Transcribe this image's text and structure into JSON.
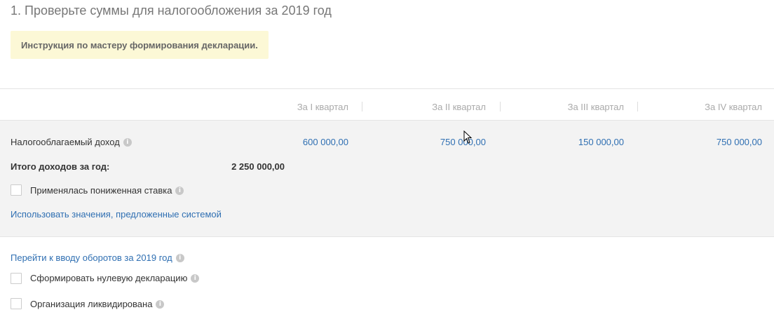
{
  "page": {
    "title": "1. Проверьте суммы для налогообложения за 2019 год"
  },
  "hint": {
    "link_text": "Инструкция по мастеру формирования декларации",
    "suffix": "."
  },
  "quarters": {
    "headers": [
      "За I квартал",
      "За II квартал",
      "За III квартал",
      "За IV квартал"
    ]
  },
  "income": {
    "label": "Налогооблагаемый доход",
    "values": [
      "600 000,00",
      "750 000,00",
      "150 000,00",
      "750 000,00"
    ]
  },
  "total": {
    "label": "Итого доходов за год:",
    "value": "2 250 000,00"
  },
  "reduced_rate": {
    "label": "Применялась пониженная ставка",
    "checked": false
  },
  "use_system_values": {
    "label": "Использовать значения, предложенные системой"
  },
  "go_to_turnover": {
    "label": "Перейти к вводу оборотов за 2019 год"
  },
  "zero_declaration": {
    "label": "Сформировать нулевую декларацию",
    "checked": false
  },
  "liquidated": {
    "label": "Организация ликвидирована",
    "checked": false
  },
  "icons": {
    "info": "i"
  },
  "colors": {
    "link": "#2f6fb2",
    "hint_bg": "#fcf8d6",
    "block_bg": "#f3f3f3"
  }
}
